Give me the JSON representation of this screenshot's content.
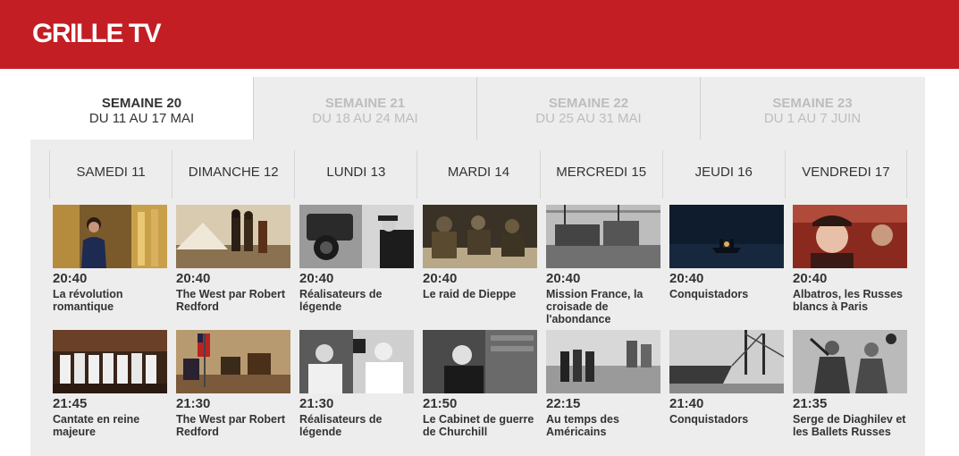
{
  "header": {
    "title": "GRILLE TV"
  },
  "colors": {
    "brand": "#c31e24",
    "panel": "#ededed"
  },
  "weeks": [
    {
      "title": "SEMAINE 20",
      "range": "DU 11 AU 17 MAI",
      "active": true
    },
    {
      "title": "SEMAINE 21",
      "range": "DU 18 AU 24 MAI",
      "active": false
    },
    {
      "title": "SEMAINE 22",
      "range": "DU 25 AU 31 MAI",
      "active": false
    },
    {
      "title": "SEMAINE 23",
      "range": "DU 1 AU 7 JUIN",
      "active": false
    }
  ],
  "days": [
    {
      "label": "SAMEDI 11"
    },
    {
      "label": "DIMANCHE 12"
    },
    {
      "label": "LUNDI 13"
    },
    {
      "label": "MARDI 14"
    },
    {
      "label": "MERCREDI 15"
    },
    {
      "label": "JEUDI 16"
    },
    {
      "label": "VENDREDI 17"
    }
  ],
  "rows": [
    {
      "programs": [
        {
          "time": "20:40",
          "title": "La révolution romantique"
        },
        {
          "time": "20:40",
          "title": "The West par Robert Redford"
        },
        {
          "time": "20:40",
          "title": "Réalisateurs de légende"
        },
        {
          "time": "20:40",
          "title": "Le raid de Dieppe"
        },
        {
          "time": "20:40",
          "title": "Mission France, la croisade de l'abondance"
        },
        {
          "time": "20:40",
          "title": "Conquistadors"
        },
        {
          "time": "20:40",
          "title": "Albatros, les Russes blancs à Paris"
        }
      ]
    },
    {
      "programs": [
        {
          "time": "21:45",
          "title": "Cantate en reine majeure"
        },
        {
          "time": "21:30",
          "title": "The West par Robert Redford"
        },
        {
          "time": "21:30",
          "title": "Réalisateurs de légende"
        },
        {
          "time": "21:50",
          "title": "Le Cabinet de guerre de Churchill"
        },
        {
          "time": "22:15",
          "title": "Au temps des Américains"
        },
        {
          "time": "21:40",
          "title": "Conquistadors"
        },
        {
          "time": "21:35",
          "title": "Serge de Diaghilev et les Ballets Russes"
        }
      ]
    }
  ]
}
